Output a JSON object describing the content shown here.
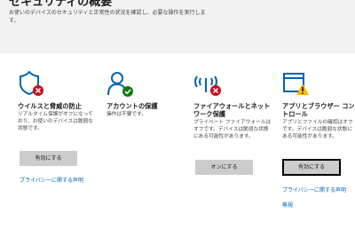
{
  "header": {
    "title": "セキュリティの概要",
    "description": "お使いのデバイスのセキュリティと正常性の状況を確認し、必要な操作を実行します。"
  },
  "cards": [
    {
      "title": "ウイルスと脅威の防止",
      "description": "リアルタイム保護がオフになっており、お使いのデバイスは脆弱な状態です。",
      "button_label": "有効にする",
      "link_label": "プライバシーに関する声明",
      "status": "error"
    },
    {
      "title": "アカウントの保護",
      "description": "操作は不要です。",
      "status": "ok"
    },
    {
      "title": "ファイアウォールとネットワーク保護",
      "description": "プライベート ファイアウォールはオフです。デバイスは脆弱な状態にある可能性があります。",
      "button_label": "オンにする",
      "status": "error"
    },
    {
      "title": "アプリとブラウザー コントロール",
      "description": "アプリとファイルの確認はオフです。デバイスは脆弱な状態にある可能性があります。",
      "button_label": "有効にする",
      "link_label": "プライバシーに関する声明",
      "link2_label": "無視",
      "status": "warning"
    }
  ],
  "colors": {
    "icon_blue": "#0063b1",
    "error_red": "#c50f1f",
    "ok_green": "#107c10",
    "warning_yellow": "#ffb900",
    "link_blue": "#0063b1",
    "button_gray": "#cccccc"
  }
}
